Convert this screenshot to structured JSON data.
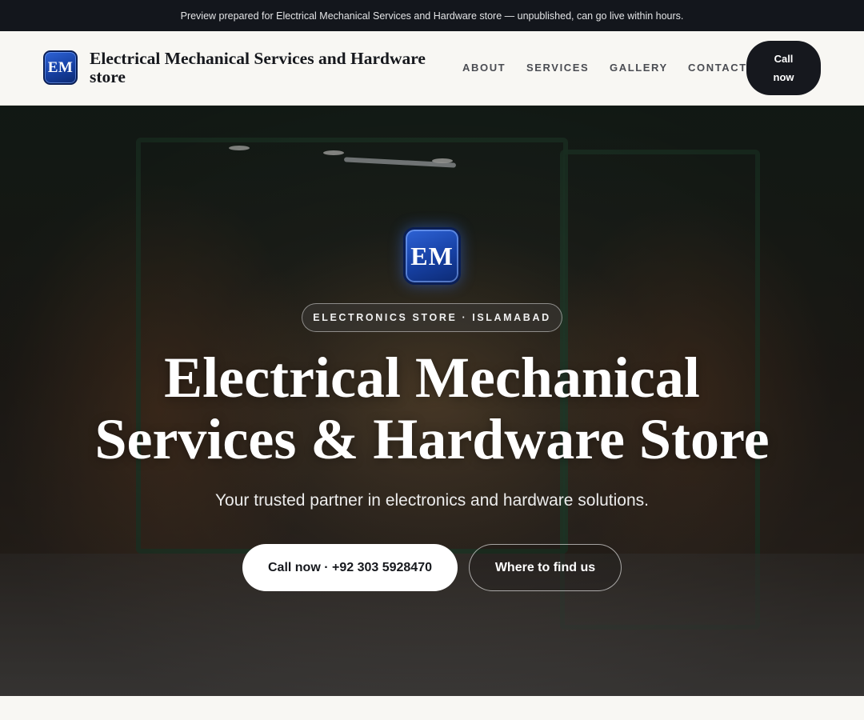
{
  "preview_banner": {
    "text": "Preview prepared for Electrical Mechanical Services and Hardware store — unpublished, can go live within hours."
  },
  "header": {
    "logo_text": "EM",
    "brand_name": "Electrical Mechanical Services and Hardware store",
    "nav": [
      "ABOUT",
      "SERVICES",
      "GALLERY",
      "CONTACT"
    ],
    "call_button": "Call now"
  },
  "hero": {
    "logo_text": "EM",
    "badge": "ELECTRONICS STORE · ISLAMABAD",
    "title_line1": "Electrical Mechanical",
    "title_line2": "Services & Hardware Store",
    "subtitle": "Your trusted partner in electronics and hardware solutions.",
    "primary_button": "Call now · +92 303 5928470",
    "secondary_button": "Where to find us"
  },
  "colors": {
    "banner_bg": "#13161c",
    "header_bg": "#f8f7f3",
    "dark_button": "#16181e",
    "logo_blue": "#1640a3"
  }
}
